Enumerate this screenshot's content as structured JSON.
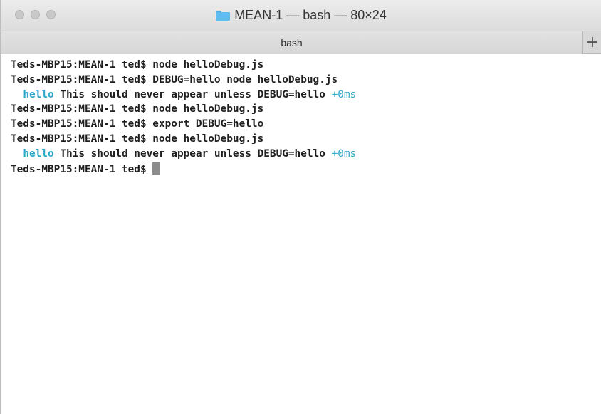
{
  "window": {
    "title": "MEAN-1 — bash — 80×24",
    "folder_icon": "folder-icon",
    "traffic_lights": [
      "close",
      "minimize",
      "zoom"
    ]
  },
  "tabs": {
    "active_label": "bash",
    "new_tab_label": "+"
  },
  "terminal": {
    "lines": [
      {
        "type": "command",
        "prompt": "Teds-MBP15:MEAN-1 ted$",
        "text": "node helloDebug.js"
      },
      {
        "type": "command",
        "prompt": "Teds-MBP15:MEAN-1 ted$",
        "text": "DEBUG=hello node helloDebug.js"
      },
      {
        "type": "debug",
        "namespace": "hello",
        "message": "This should never appear unless DEBUG=hello",
        "delta": "+0ms"
      },
      {
        "type": "command",
        "prompt": "Teds-MBP15:MEAN-1 ted$",
        "text": "node helloDebug.js"
      },
      {
        "type": "command",
        "prompt": "Teds-MBP15:MEAN-1 ted$",
        "text": "export DEBUG=hello"
      },
      {
        "type": "command",
        "prompt": "Teds-MBP15:MEAN-1 ted$",
        "text": "node helloDebug.js"
      },
      {
        "type": "debug",
        "namespace": "hello",
        "message": "This should never appear unless DEBUG=hello",
        "delta": "+0ms"
      },
      {
        "type": "prompt",
        "prompt": "Teds-MBP15:MEAN-1 ted$",
        "text": ""
      }
    ],
    "colors": {
      "foreground": "#1f1f1f",
      "debug_namespace": "#2aa7c9",
      "cursor": "#8c8c8c"
    }
  }
}
